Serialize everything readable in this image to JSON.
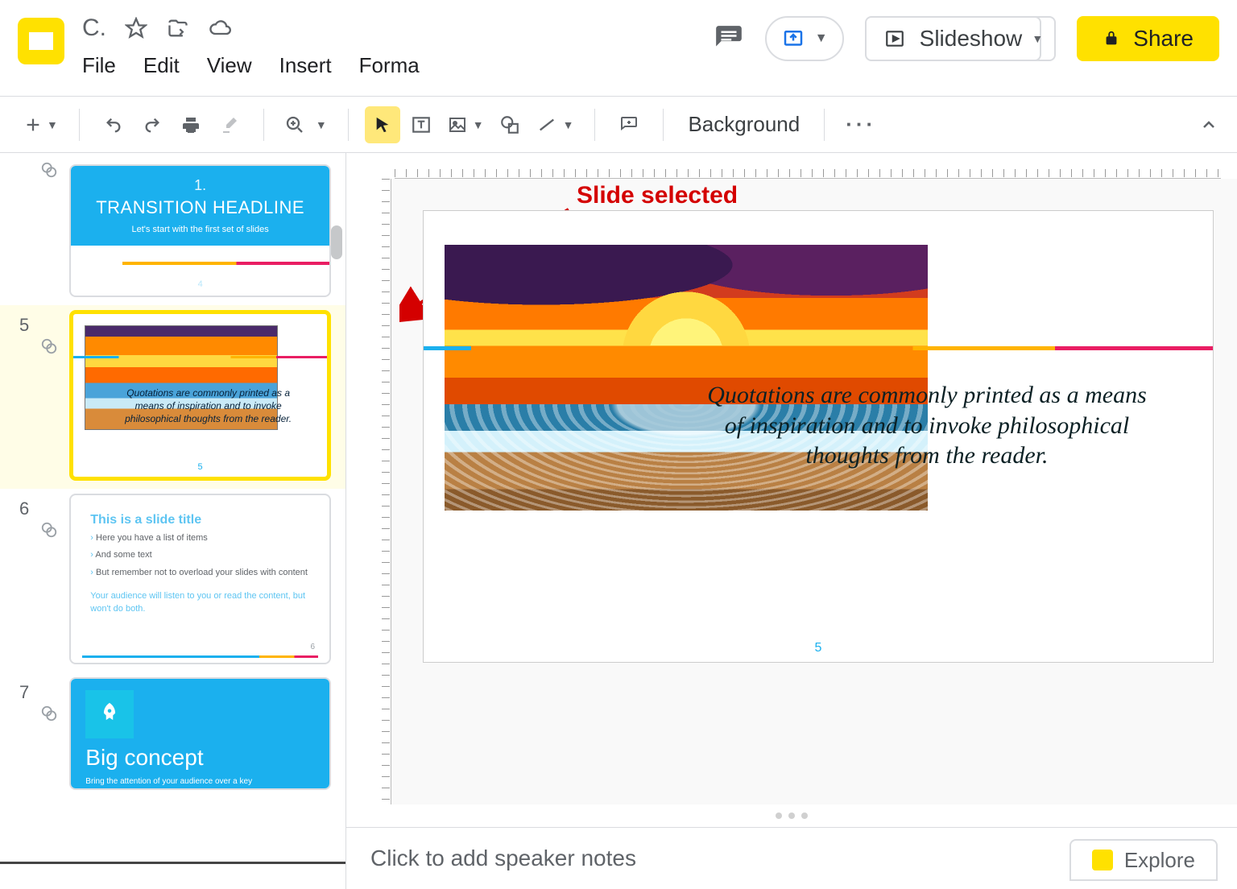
{
  "doc_initial": "C.",
  "menu": {
    "file": "File",
    "edit": "Edit",
    "view": "View",
    "insert": "Insert",
    "format": "Forma"
  },
  "header": {
    "slideshow": "Slideshow",
    "share": "Share"
  },
  "toolbar": {
    "background": "Background"
  },
  "annotation": "Slide selected",
  "notes_placeholder": "Click to add speaker notes",
  "explore": "Explore",
  "canvas": {
    "quote": "Quotations are commonly printed as a means of inspiration and to invoke philosophical thoughts from the reader.",
    "slide_number": "5"
  },
  "thumbs": {
    "s4": {
      "num": "1.",
      "headline": "TRANSITION HEADLINE",
      "sub": "Let's start with the first set of slides",
      "page": "4"
    },
    "s5": {
      "num": "5",
      "quote": "Quotations are commonly printed as a means of inspiration and to invoke philosophical thoughts from the reader.",
      "page": "5"
    },
    "s6": {
      "num": "6",
      "title": "This is a slide title",
      "li1": "Here you have a list of items",
      "li2": "And some text",
      "li3": "But remember not to overload your slides with content",
      "note": "Your audience will listen to you or read the content, but won't do both.",
      "page": "6"
    },
    "s7": {
      "num": "7",
      "title": "Big concept",
      "sub": "Bring the attention of your audience over a key"
    }
  }
}
